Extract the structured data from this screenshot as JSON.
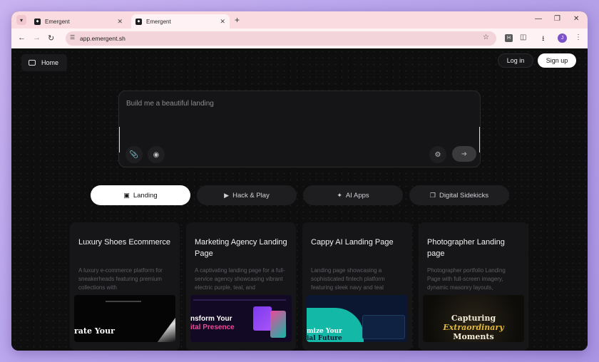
{
  "browser": {
    "tabs": [
      {
        "title": "Emergent",
        "active": false
      },
      {
        "title": "Emergent",
        "active": true
      }
    ],
    "url": "app.emergent.sh",
    "profile_initial": "J",
    "extension_letter": "H"
  },
  "nav": {
    "home_label": "Home",
    "login_label": "Log in",
    "signup_label": "Sign up"
  },
  "prompt": {
    "text": "Build me a beautiful landing"
  },
  "categories": [
    {
      "label": "Landing",
      "icon": "window-icon",
      "active": true
    },
    {
      "label": "Hack & Play",
      "icon": "play-icon",
      "active": false
    },
    {
      "label": "AI Apps",
      "icon": "sparkle-icon",
      "active": false
    },
    {
      "label": "Digital Sidekicks",
      "icon": "copy-icon",
      "active": false
    }
  ],
  "cards": [
    {
      "title": "Luxury Shoes Ecommerce",
      "description": "A luxury e-commerce platform for sneakerheads featuring premium collections with",
      "thumb_text": "rate Your"
    },
    {
      "title": "Marketing Agency Landing Page",
      "description": "A captivating landing page for a full-service agency showcasing vibrant electric purple, teal, and",
      "thumb_text": "nsform Your",
      "thumb_text_2": "ital Presence"
    },
    {
      "title": "Cappy AI Landing Page",
      "description": "Landing page showcasing a sophisticated fintech platform featuring sleek navy and teal",
      "thumb_text": "mize Your",
      "thumb_text_2": "ial Future"
    },
    {
      "title": "Photographer Landing page",
      "description": "Photographer portfolio Landing Page with full-screen imagery, dynamic masonry layouts,",
      "thumb_text": "Capturing",
      "thumb_text_2": "Extraordinary",
      "thumb_text_3": "Moments"
    }
  ],
  "colors": {
    "page_bg": "#0e0e0f",
    "tabstrip_bg": "#f9dbe0",
    "accent_gold": "#e2b93b",
    "teal": "#14b8a6",
    "pink": "#ec4899"
  }
}
